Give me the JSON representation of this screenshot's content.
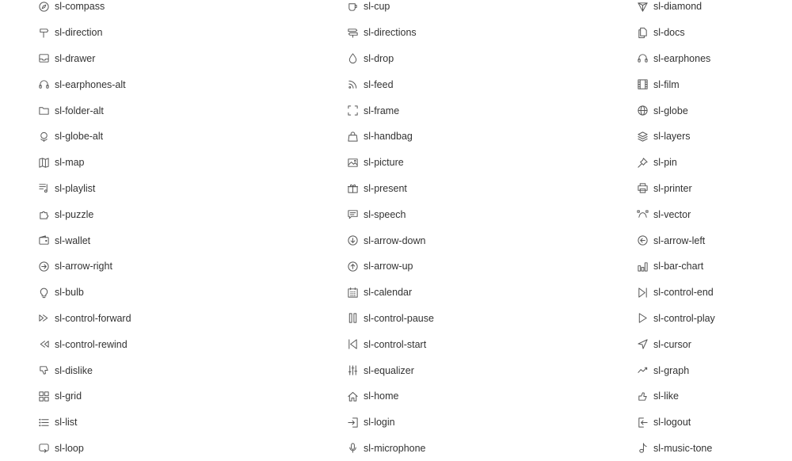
{
  "columns": [
    [
      {
        "label": "sl-compass",
        "icon": "compass-icon"
      },
      {
        "label": "sl-direction",
        "icon": "direction-icon"
      },
      {
        "label": "sl-drawer",
        "icon": "drawer-icon"
      },
      {
        "label": "sl-earphones-alt",
        "icon": "earphones-alt-icon"
      },
      {
        "label": "sl-folder-alt",
        "icon": "folder-alt-icon"
      },
      {
        "label": "sl-globe-alt",
        "icon": "globe-alt-icon"
      },
      {
        "label": "sl-map",
        "icon": "map-icon"
      },
      {
        "label": "sl-playlist",
        "icon": "playlist-icon"
      },
      {
        "label": "sl-puzzle",
        "icon": "puzzle-icon"
      },
      {
        "label": "sl-wallet",
        "icon": "wallet-icon"
      },
      {
        "label": "sl-arrow-right",
        "icon": "arrow-right-icon"
      },
      {
        "label": "sl-bulb",
        "icon": "bulb-icon"
      },
      {
        "label": "sl-control-forward",
        "icon": "control-forward-icon"
      },
      {
        "label": "sl-control-rewind",
        "icon": "control-rewind-icon"
      },
      {
        "label": "sl-dislike",
        "icon": "dislike-icon"
      },
      {
        "label": "sl-grid",
        "icon": "grid-icon"
      },
      {
        "label": "sl-list",
        "icon": "list-icon"
      },
      {
        "label": "sl-loop",
        "icon": "loop-icon"
      }
    ],
    [
      {
        "label": "sl-cup",
        "icon": "cup-icon"
      },
      {
        "label": "sl-directions",
        "icon": "directions-icon"
      },
      {
        "label": "sl-drop",
        "icon": "drop-icon"
      },
      {
        "label": "sl-feed",
        "icon": "feed-icon"
      },
      {
        "label": "sl-frame",
        "icon": "frame-icon"
      },
      {
        "label": "sl-handbag",
        "icon": "handbag-icon"
      },
      {
        "label": "sl-picture",
        "icon": "picture-icon"
      },
      {
        "label": "sl-present",
        "icon": "present-icon"
      },
      {
        "label": "sl-speech",
        "icon": "speech-icon"
      },
      {
        "label": "sl-arrow-down",
        "icon": "arrow-down-icon"
      },
      {
        "label": "sl-arrow-up",
        "icon": "arrow-up-icon"
      },
      {
        "label": "sl-calendar",
        "icon": "calendar-icon"
      },
      {
        "label": "sl-control-pause",
        "icon": "control-pause-icon"
      },
      {
        "label": "sl-control-start",
        "icon": "control-start-icon"
      },
      {
        "label": "sl-equalizer",
        "icon": "equalizer-icon"
      },
      {
        "label": "sl-home",
        "icon": "home-icon"
      },
      {
        "label": "sl-login",
        "icon": "login-icon"
      },
      {
        "label": "sl-microphone",
        "icon": "microphone-icon"
      }
    ],
    [
      {
        "label": "sl-diamond",
        "icon": "diamond-icon"
      },
      {
        "label": "sl-docs",
        "icon": "docs-icon"
      },
      {
        "label": "sl-earphones",
        "icon": "earphones-icon"
      },
      {
        "label": "sl-film",
        "icon": "film-icon"
      },
      {
        "label": "sl-globe",
        "icon": "globe-icon"
      },
      {
        "label": "sl-layers",
        "icon": "layers-icon"
      },
      {
        "label": "sl-pin",
        "icon": "pin-icon"
      },
      {
        "label": "sl-printer",
        "icon": "printer-icon"
      },
      {
        "label": "sl-vector",
        "icon": "vector-icon"
      },
      {
        "label": "sl-arrow-left",
        "icon": "arrow-left-icon"
      },
      {
        "label": "sl-bar-chart",
        "icon": "bar-chart-icon"
      },
      {
        "label": "sl-control-end",
        "icon": "control-end-icon"
      },
      {
        "label": "sl-control-play",
        "icon": "control-play-icon"
      },
      {
        "label": "sl-cursor",
        "icon": "cursor-icon"
      },
      {
        "label": "sl-graph",
        "icon": "graph-icon"
      },
      {
        "label": "sl-like",
        "icon": "like-icon"
      },
      {
        "label": "sl-logout",
        "icon": "logout-icon"
      },
      {
        "label": "sl-music-tone",
        "icon": "music-tone-icon"
      }
    ]
  ]
}
